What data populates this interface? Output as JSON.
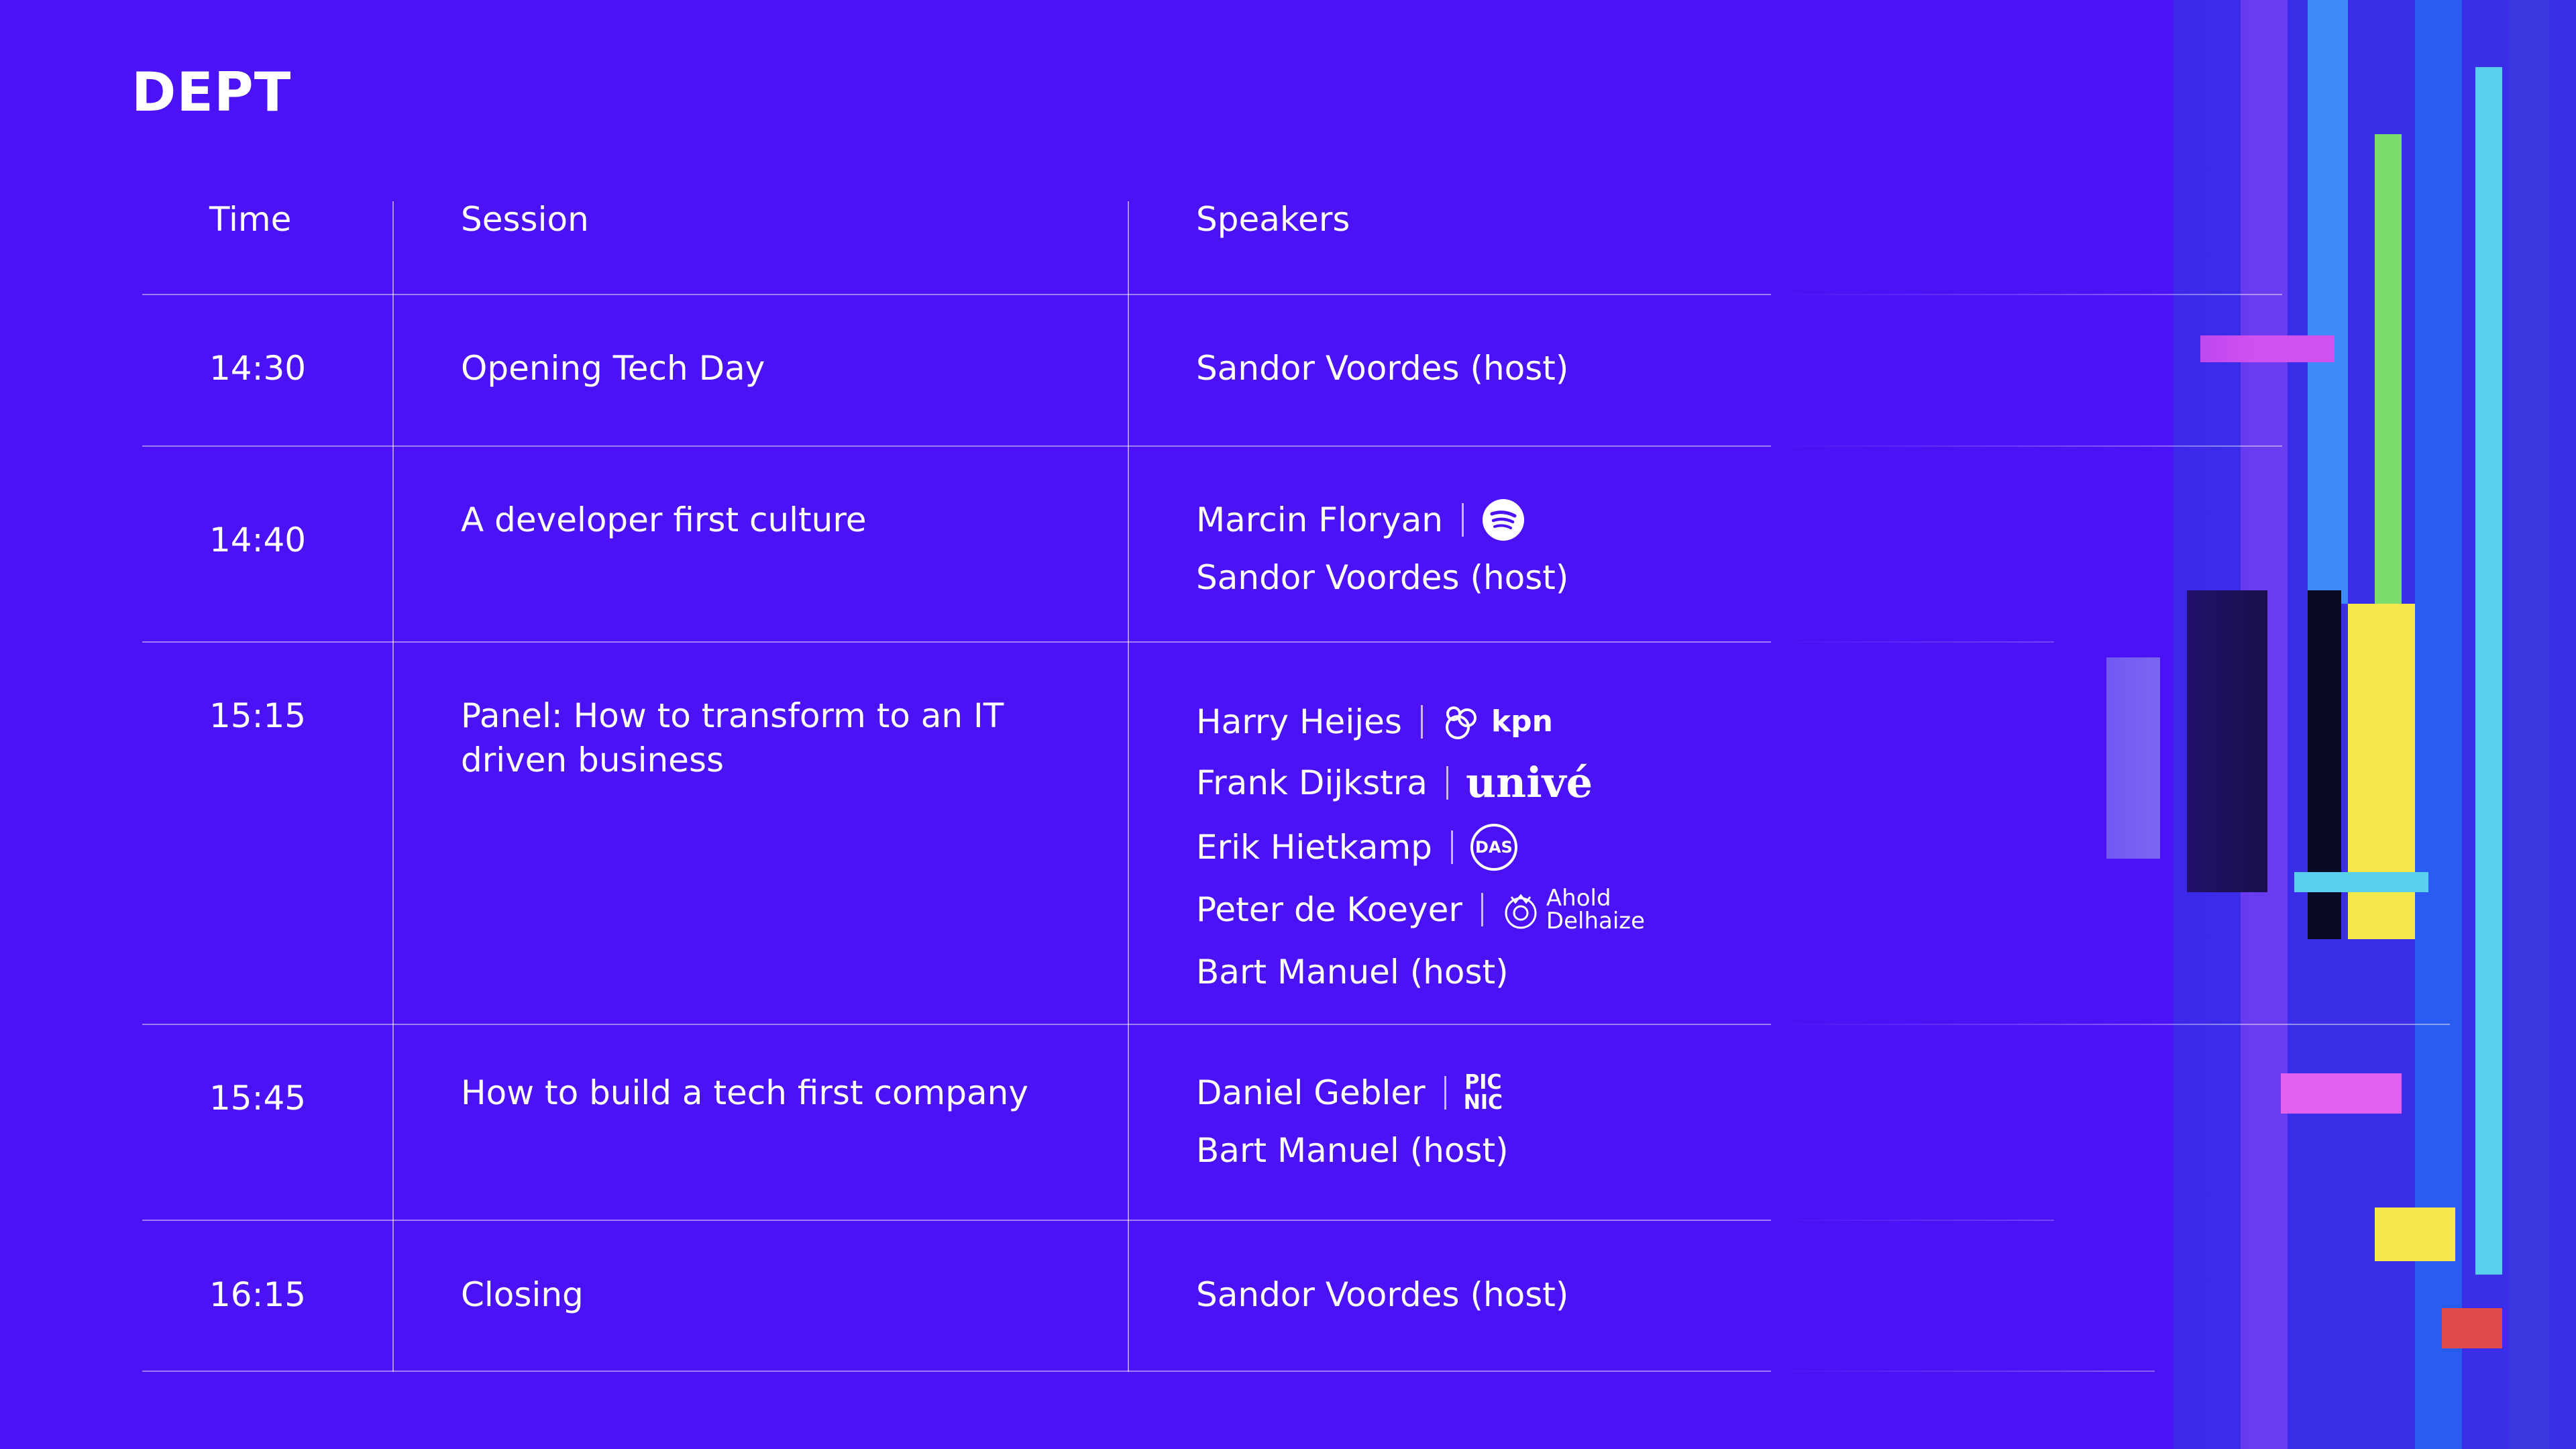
{
  "brand": "DEPT",
  "headers": {
    "time": "Time",
    "session": "Session",
    "speakers": "Speakers"
  },
  "rows": [
    {
      "time": "14:30",
      "session": [
        "Opening Tech Day"
      ],
      "speakers": [
        {
          "name": "Sandor Voordes (host)"
        }
      ]
    },
    {
      "time": "14:40",
      "session": [
        "A developer first culture"
      ],
      "speakers": [
        {
          "name": "Marcin Floryan",
          "company": "spotify"
        },
        {
          "name": "Sandor Voordes (host)"
        }
      ]
    },
    {
      "time": "15:15",
      "session": [
        "Panel: How to transform to an IT",
        "driven business"
      ],
      "speakers": [
        {
          "name": "Harry Heijes",
          "company": "kpn",
          "company_text": "kpn"
        },
        {
          "name": "Frank Dijkstra",
          "company": "unive",
          "company_text": "univé"
        },
        {
          "name": "Erik Hietkamp",
          "company": "das",
          "company_text": "DAS"
        },
        {
          "name": "Peter de Koeyer",
          "company": "ahold-delhaize",
          "company_text": [
            "Ahold",
            "Delhaize"
          ]
        },
        {
          "name": "Bart Manuel (host)"
        }
      ]
    },
    {
      "time": "15:45",
      "session": [
        "How to build a tech first company"
      ],
      "speakers": [
        {
          "name": "Daniel Gebler",
          "company": "picnic",
          "company_text": [
            "PIC",
            "NIC"
          ]
        },
        {
          "name": "Bart Manuel (host)"
        }
      ]
    },
    {
      "time": "16:15",
      "session": [
        "Closing"
      ],
      "speakers": [
        {
          "name": "Sandor Voordes (host)"
        }
      ]
    }
  ],
  "colors": {
    "background": "#4a12f5",
    "text": "#ffffff"
  }
}
